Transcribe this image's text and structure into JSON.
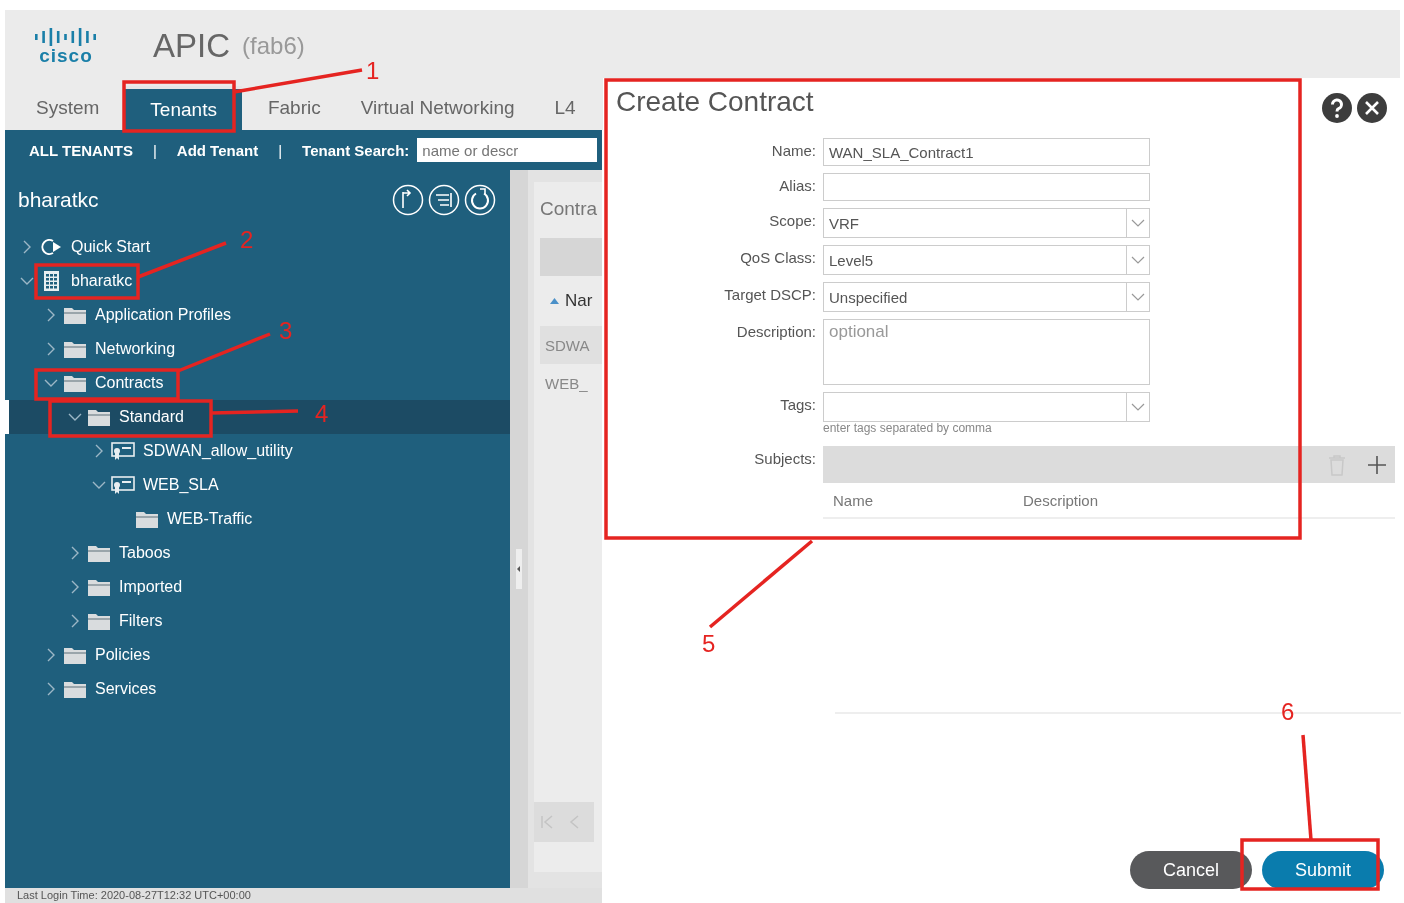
{
  "header": {
    "logo_text": "cisco",
    "title": "APIC",
    "subtitle": "(fab6)"
  },
  "tabs": [
    {
      "label": "System",
      "selected": false
    },
    {
      "label": "Tenants",
      "selected": true
    },
    {
      "label": "Fabric",
      "selected": false
    },
    {
      "label": "Virtual Networking",
      "selected": false
    },
    {
      "label": "L4",
      "selected": false
    }
  ],
  "tenant_bar": {
    "links": [
      "ALL TENANTS",
      "Add Tenant"
    ],
    "separators": [
      "|",
      "|"
    ],
    "search_label": "Tenant Search:",
    "search_placeholder": "name or descr"
  },
  "sidebar": {
    "title": "bharatkc",
    "tree": [
      {
        "label": "Quick Start",
        "kind": "quickstart",
        "expanded": false,
        "selected": false
      },
      {
        "label": "bharatkc",
        "kind": "tenant",
        "expanded": true,
        "selected": false,
        "children": [
          {
            "label": "Application Profiles",
            "kind": "folder",
            "expanded": false,
            "selected": false
          },
          {
            "label": "Networking",
            "kind": "folder",
            "expanded": false,
            "selected": false
          },
          {
            "label": "Contracts",
            "kind": "folder",
            "expanded": true,
            "selected": false,
            "children": [
              {
                "label": "Standard",
                "kind": "folder",
                "expanded": true,
                "selected": true,
                "children": [
                  {
                    "label": "SDWAN_allow_utility",
                    "kind": "contract",
                    "expanded": false,
                    "selected": false
                  },
                  {
                    "label": "WEB_SLA",
                    "kind": "contract",
                    "expanded": true,
                    "selected": false,
                    "children": [
                      {
                        "label": "WEB-Traffic",
                        "kind": "folder",
                        "selected": false
                      }
                    ]
                  }
                ]
              },
              {
                "label": "Taboos",
                "kind": "folder",
                "expanded": false,
                "selected": false
              },
              {
                "label": "Imported",
                "kind": "folder",
                "expanded": false,
                "selected": false
              },
              {
                "label": "Filters",
                "kind": "folder",
                "expanded": false,
                "selected": false
              }
            ]
          },
          {
            "label": "Policies",
            "kind": "folder",
            "expanded": false,
            "selected": false
          },
          {
            "label": "Services",
            "kind": "folder",
            "expanded": false,
            "selected": false
          }
        ]
      }
    ]
  },
  "content": {
    "title": "Contra",
    "column": "Nar",
    "rows": [
      {
        "label": "SDWA",
        "selected": true
      },
      {
        "label": "WEB_",
        "selected": false
      }
    ]
  },
  "footer": {
    "text": "Last Login Time: 2020-08-27T12:32 UTC+00:00"
  },
  "dialog": {
    "title": "Create Contract",
    "fields": [
      {
        "label": "Name:",
        "kind": "text",
        "value": "WAN_SLA_Contract1"
      },
      {
        "label": "Alias:",
        "kind": "text"
      },
      {
        "label": "Scope:",
        "kind": "select",
        "value": "VRF"
      },
      {
        "label": "QoS Class:",
        "kind": "select",
        "value": "Level5"
      },
      {
        "label": "Target DSCP:",
        "kind": "select",
        "value": "Unspecified"
      },
      {
        "label": "Description:",
        "kind": "textarea",
        "placeholder": "optional"
      },
      {
        "label": "Tags:",
        "kind": "select",
        "hint": "enter tags separated by comma"
      }
    ],
    "subjects": {
      "label": "Subjects:",
      "columns": [
        "Name",
        "Description"
      ]
    },
    "buttons": [
      {
        "label": "Cancel",
        "kind": "secondary"
      },
      {
        "label": "Submit",
        "kind": "primary"
      }
    ]
  },
  "annotations": [
    {
      "label": "1"
    },
    {
      "label": "2"
    },
    {
      "label": "3"
    },
    {
      "label": "4"
    },
    {
      "label": "5"
    },
    {
      "label": "6"
    }
  ]
}
